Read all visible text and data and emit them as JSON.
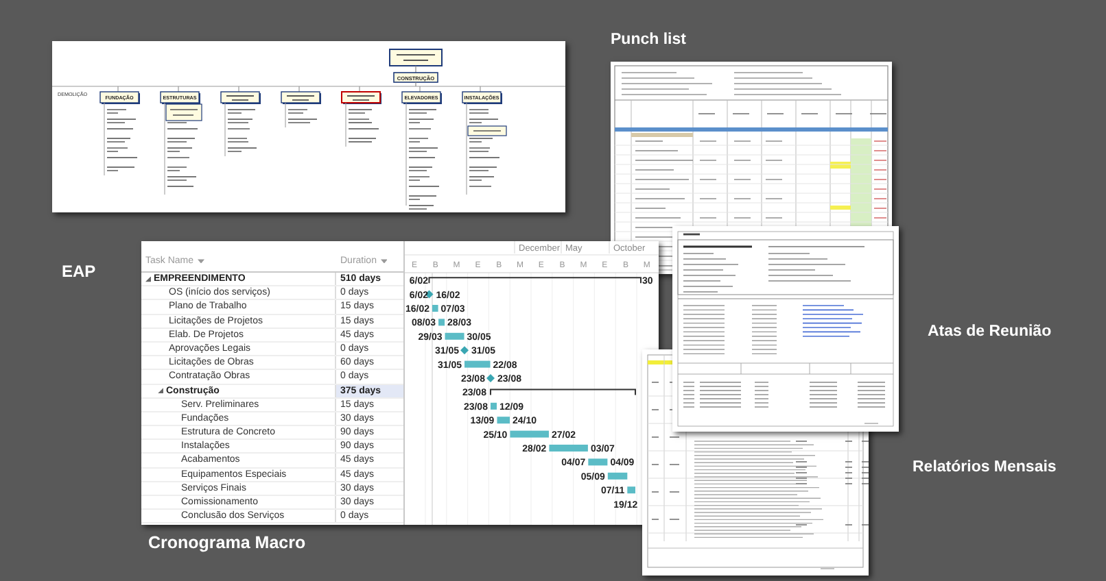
{
  "eap": {
    "caption": "EAP",
    "root": "CONSTRUÇÃO",
    "side_item": "DEMOLIÇÃO",
    "branches": [
      {
        "label": "FUNDAÇÃO",
        "highlighted": false
      },
      {
        "label": "ESTRUTURAS",
        "highlighted": false
      },
      {
        "highlighted": false
      },
      {
        "highlighted": false
      },
      {
        "highlighted": true
      },
      {
        "label": "ELEVADORES",
        "highlighted": false
      },
      {
        "label": "INSTALAÇÕES",
        "highlighted": false
      }
    ]
  },
  "schedule": {
    "caption": "Cronograma Macro",
    "columns": [
      "Task Name",
      "Duration"
    ],
    "months": [
      "December",
      "May",
      "October"
    ],
    "units": [
      "E",
      "B",
      "M",
      "E",
      "B",
      "M",
      "E",
      "B",
      "M",
      "E",
      "B",
      "M"
    ],
    "tasks": [
      {
        "name": "EMPREENDIMENTO",
        "duration": "510 days",
        "kind": "summary",
        "expanded": true,
        "start": "6/02",
        "end": "30",
        "children": [
          {
            "name": "OS (início dos serviços)",
            "duration": "0 days",
            "kind": "milestone",
            "start": "6/02",
            "end": "16/02"
          },
          {
            "name": "Plano de Trabalho",
            "duration": "15 days",
            "kind": "task",
            "start": "16/02",
            "end": "07/03"
          },
          {
            "name": "Licitações de Projetos",
            "duration": "15 days",
            "kind": "task",
            "start": "08/03",
            "end": "28/03"
          },
          {
            "name": "Elab. De Projetos",
            "duration": "45 days",
            "kind": "task",
            "start": "29/03",
            "end": "30/05"
          },
          {
            "name": "Aprovações Legais",
            "duration": "0 days",
            "kind": "milestone",
            "start": "31/05",
            "end": "31/05"
          },
          {
            "name": "Licitações de Obras",
            "duration": "60 days",
            "kind": "task",
            "start": "31/05",
            "end": "22/08"
          },
          {
            "name": "Contratação Obras",
            "duration": "0 days",
            "kind": "milestone",
            "start": "23/08",
            "end": "23/08"
          },
          {
            "name": "Construção",
            "duration": "375 days",
            "kind": "summary",
            "expanded": true,
            "start": "23/08",
            "children": [
              {
                "name": "Serv. Preliminares",
                "duration": "15 days",
                "kind": "task",
                "start": "23/08",
                "end": "12/09"
              },
              {
                "name": "Fundações",
                "duration": "30 days",
                "kind": "task",
                "start": "13/09",
                "end": "24/10"
              },
              {
                "name": "Estrutura de Concreto",
                "duration": "90 days",
                "kind": "task",
                "start": "25/10",
                "end": "27/02"
              },
              {
                "name": "Instalações",
                "duration": "90 days",
                "kind": "task",
                "start": "28/02",
                "end": "03/07"
              },
              {
                "name": "Acabamentos",
                "duration": "45 days",
                "kind": "task",
                "start": "04/07",
                "end": "04/09"
              },
              {
                "name": "Equipamentos Especiais",
                "duration": "45 days",
                "kind": "task",
                "start": "05/09"
              },
              {
                "name": "Serviços Finais",
                "duration": "30 days",
                "kind": "task",
                "start": "07/11"
              },
              {
                "name": "Comissionamento",
                "duration": "30 days",
                "kind": "task",
                "start": "19/12"
              },
              {
                "name": "Conclusão dos Serviços",
                "duration": "0 days",
                "kind": "milestone"
              }
            ]
          }
        ]
      }
    ]
  },
  "punch_list": {
    "caption": "Punch list"
  },
  "meeting_minutes": {
    "caption": "Atas de Reunião"
  },
  "monthly_reports": {
    "caption": "Relatórios Mensais"
  }
}
